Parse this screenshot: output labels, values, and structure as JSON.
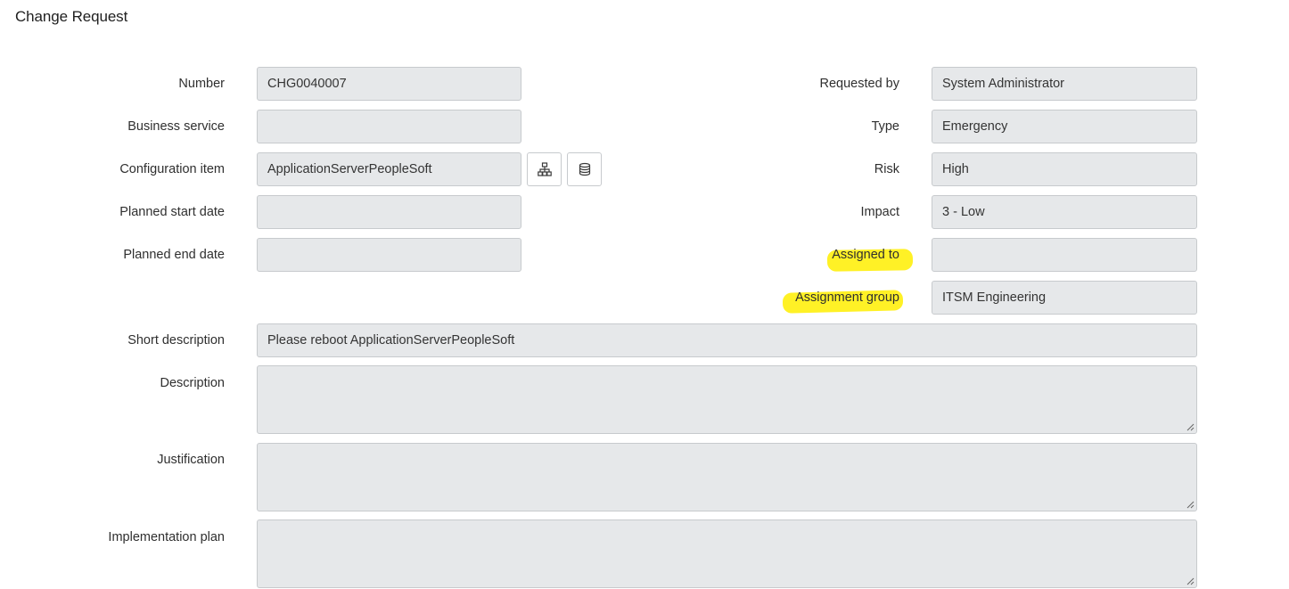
{
  "form": {
    "title": "Change Request"
  },
  "left_fields": {
    "number": {
      "label": "Number",
      "value": "CHG0040007"
    },
    "business_service": {
      "label": "Business service",
      "value": ""
    },
    "configuration_item": {
      "label": "Configuration item",
      "value": "ApplicationServerPeopleSoft"
    },
    "planned_start_date": {
      "label": "Planned start date",
      "value": ""
    },
    "planned_end_date": {
      "label": "Planned end date",
      "value": ""
    }
  },
  "right_fields": {
    "requested_by": {
      "label": "Requested by",
      "value": "System Administrator"
    },
    "type": {
      "label": "Type",
      "value": "Emergency"
    },
    "risk": {
      "label": "Risk",
      "value": "High"
    },
    "impact": {
      "label": "Impact",
      "value": "3 - Low"
    },
    "assigned_to": {
      "label": "Assigned to",
      "value": ""
    },
    "assignment_group": {
      "label": "Assignment group",
      "value": "ITSM Engineering"
    }
  },
  "wide_fields": {
    "short_description": {
      "label": "Short description",
      "value": "Please reboot ApplicationServerPeopleSoft"
    },
    "description": {
      "label": "Description",
      "value": ""
    },
    "justification": {
      "label": "Justification",
      "value": ""
    },
    "implementation_plan": {
      "label": "Implementation plan",
      "value": ""
    }
  },
  "icons": {
    "dependency_map": "hierarchy-icon",
    "ci_database": "database-icon"
  },
  "colors": {
    "field_background": "#e6e8ea",
    "field_border": "#c7cacd",
    "highlight": "#ffee00"
  }
}
